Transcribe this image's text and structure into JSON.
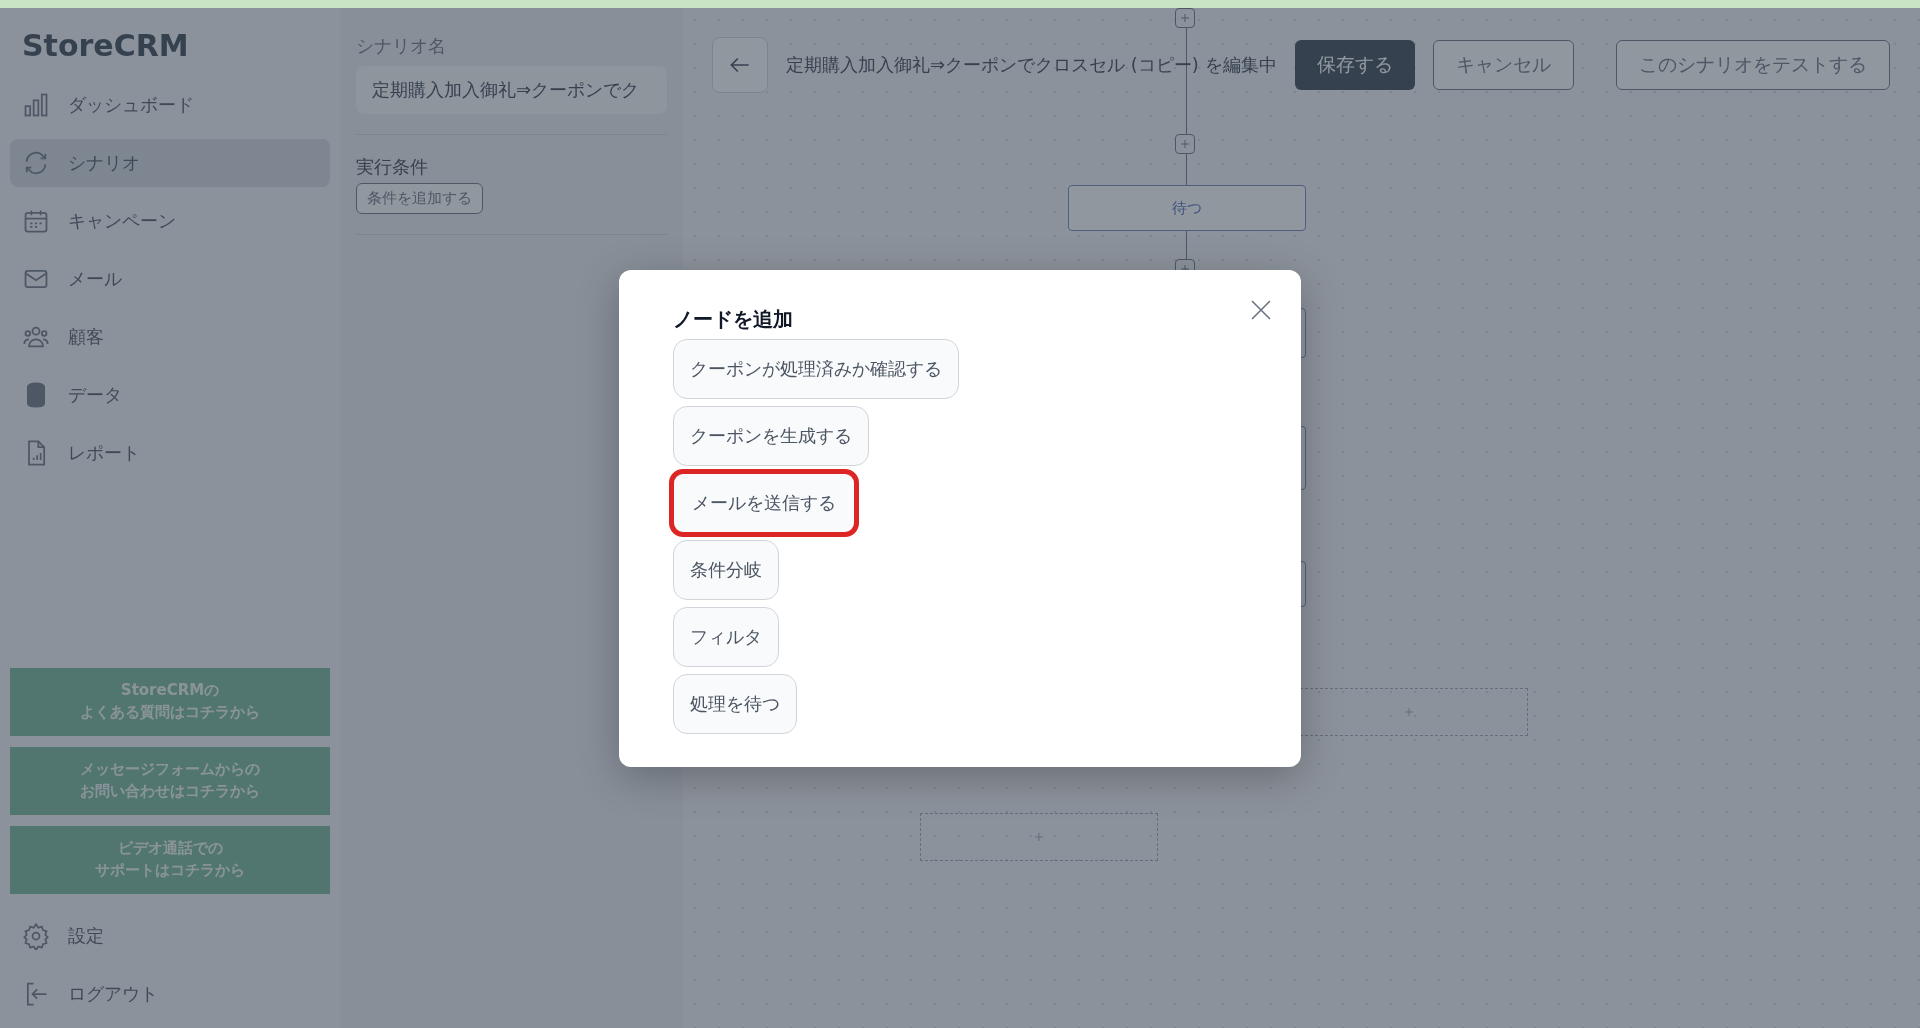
{
  "sidebar": {
    "logo": "StoreCRM",
    "items": [
      {
        "label": "ダッシュボード",
        "selected": false
      },
      {
        "label": "シナリオ",
        "selected": true
      },
      {
        "label": "キャンペーン",
        "selected": false
      },
      {
        "label": "メール",
        "selected": false
      },
      {
        "label": "顧客",
        "selected": false
      },
      {
        "label": "データ",
        "selected": false
      },
      {
        "label": "レポート",
        "selected": false
      }
    ],
    "help_buttons": [
      [
        "StoreCRMの",
        "よくある質問はコチラから"
      ],
      [
        "メッセージフォームからの",
        "お問い合わせはコチラから"
      ],
      [
        "ビデオ通話での",
        "サポートはコチラから"
      ]
    ],
    "bottom_items": [
      {
        "label": "設定"
      },
      {
        "label": "ログアウト"
      }
    ]
  },
  "scenario_panel": {
    "name_label": "シナリオ名",
    "name_value": "定期購入加入御礼⇒クーポンでク",
    "conditions_label": "実行条件",
    "add_condition_button": "条件を追加する"
  },
  "editor_bar": {
    "title": "定期購入加入御礼⇒クーポンでクロスセル (コピー) を編集中",
    "save_button": "保存する",
    "cancel_button": "キャンセル",
    "test_button": "このシナリオをテストする"
  },
  "canvas": {
    "wait_node": "待つ"
  },
  "modal": {
    "title": "ノードを追加",
    "options": [
      {
        "label": "クーポンが処理済みか確認する",
        "highlighted": false
      },
      {
        "label": "クーポンを生成する",
        "highlighted": false
      },
      {
        "label": "メールを送信する",
        "highlighted": true
      },
      {
        "label": "条件分岐",
        "highlighted": false
      },
      {
        "label": "フィルタ",
        "highlighted": false
      },
      {
        "label": "処理を待つ",
        "highlighted": false
      }
    ]
  }
}
